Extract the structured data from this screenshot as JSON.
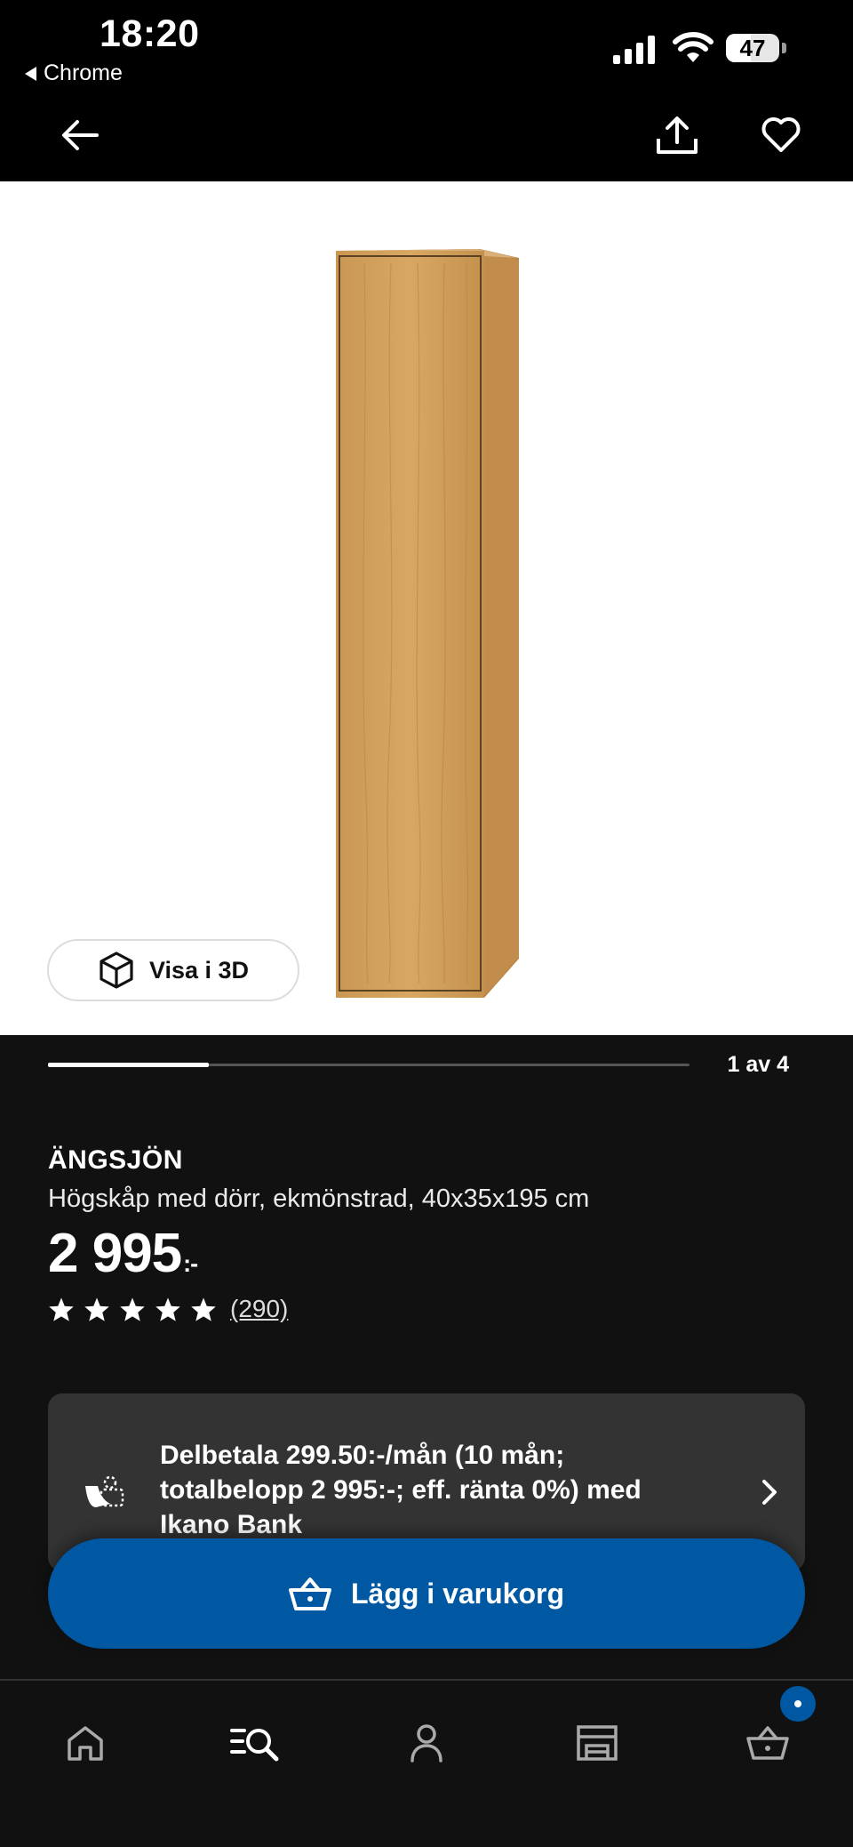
{
  "status_bar": {
    "time": "18:20",
    "back_app": "Chrome",
    "battery": "47",
    "battery_level": 0.47,
    "icons": [
      "signal-icon",
      "wifi-icon",
      "battery-icon"
    ]
  },
  "header": {
    "icons": [
      "arrow-left-icon",
      "share-icon",
      "heart-icon"
    ]
  },
  "gallery": {
    "view_3d_label": "Visa i 3D",
    "counter": "1 av 4",
    "progress": 0.25,
    "image": "wooden-tall-cabinet-image"
  },
  "product": {
    "name": "ÄNGSJÖN",
    "description": "Högskåp med dörr, ekmönstrad, 40x35x195 cm",
    "price": "2 995",
    "price_suffix": ":-",
    "rating_stars": 5,
    "review_count": "(290)"
  },
  "financing": {
    "text": "Delbetala 299.50:-/mån (10 mån; totalbelopp 2 995:-; eff. ränta 0%) med Ikano Bank",
    "icon": "coins-hand-icon"
  },
  "cart_button": {
    "label": "Lägg i varukorg",
    "icon": "basket-icon"
  },
  "bottom_nav": {
    "items": [
      "home-icon",
      "search-list-icon",
      "profile-icon",
      "store-icon",
      "basket-icon"
    ],
    "cart_badge": "•"
  },
  "colors": {
    "background": "#111111",
    "status_bar": "#000000",
    "accent_blue": "#0058a3",
    "card": "#333333"
  }
}
